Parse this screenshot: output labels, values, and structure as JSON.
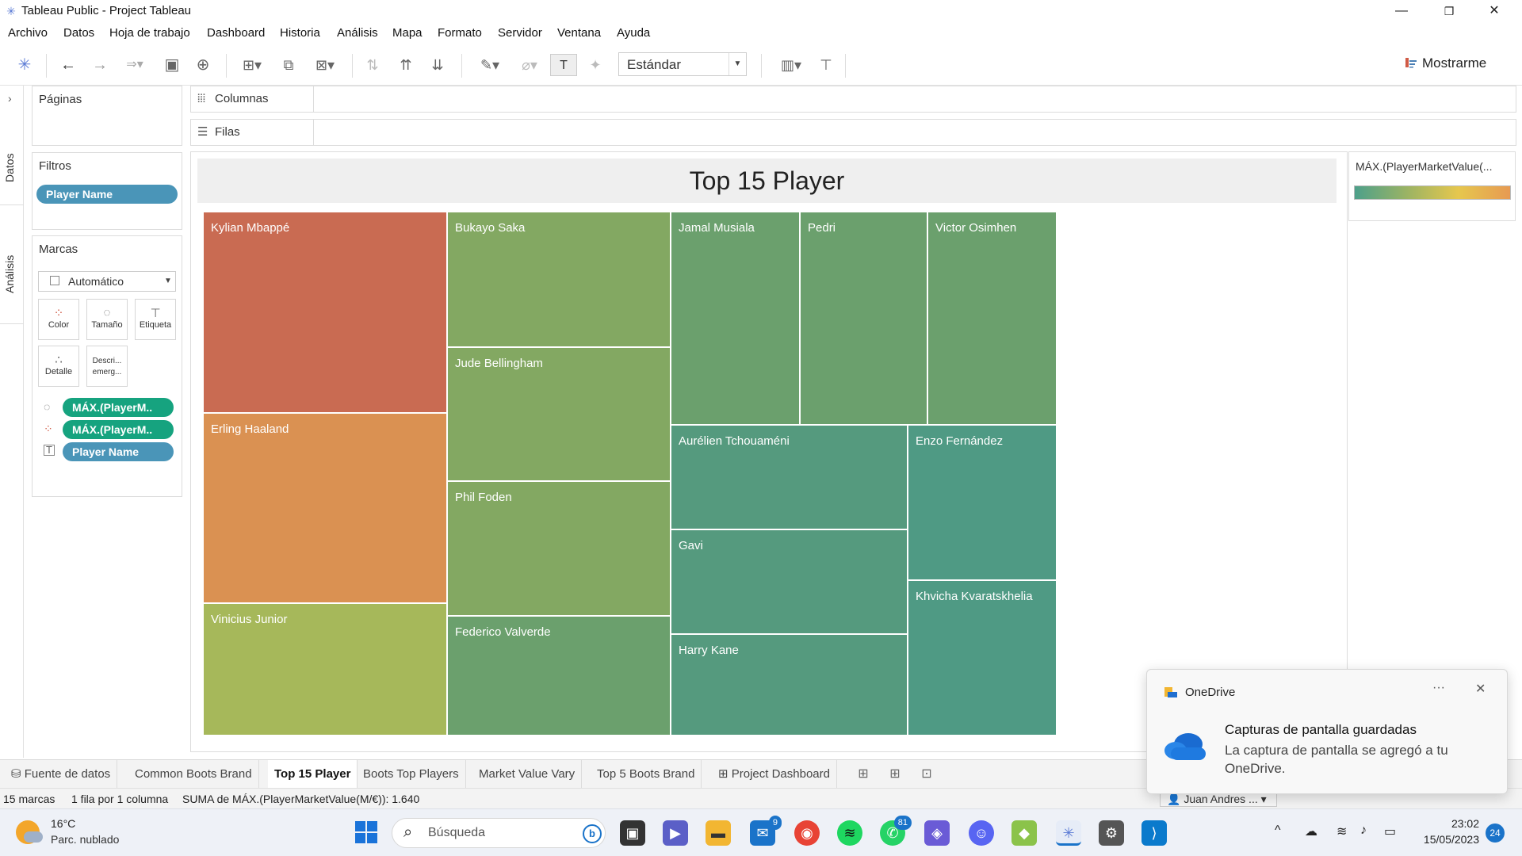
{
  "window": {
    "title": "Tableau Public - Project Tableau",
    "minimize": "—",
    "maximize": "❐",
    "close": "✕"
  },
  "menu": [
    "Archivo",
    "Datos",
    "Hoja de trabajo",
    "Dashboard",
    "Historia",
    "Análisis",
    "Mapa",
    "Formato",
    "Servidor",
    "Ventana",
    "Ayuda"
  ],
  "toolbar": {
    "fit_select": "Estándar",
    "show_me": "Mostrarme"
  },
  "side_tabs": {
    "data": "Datos",
    "analysis": "Análisis"
  },
  "pages": {
    "title": "Páginas"
  },
  "filters": {
    "title": "Filtros",
    "pills": [
      "Player Name"
    ]
  },
  "marks": {
    "title": "Marcas",
    "type": "Automático",
    "buttons": {
      "color": "Color",
      "size": "Tamaño",
      "label": "Etiqueta",
      "detail": "Detalle",
      "tooltip": "Descri... emerg..."
    },
    "pills": [
      "MÁX.(PlayerM..",
      "MÁX.(PlayerM..",
      "Player Name"
    ]
  },
  "shelves": {
    "columns": "Columnas",
    "rows": "Filas"
  },
  "view": {
    "title": "Top 15 Player"
  },
  "treemap": [
    {
      "name": "Kylian Mbappé",
      "color": "#c96b52"
    },
    {
      "name": "Erling Haaland",
      "color": "#da9152"
    },
    {
      "name": "Vinicius Junior",
      "color": "#a6b85a"
    },
    {
      "name": "Bukayo Saka",
      "color": "#83a862"
    },
    {
      "name": "Jude Bellingham",
      "color": "#83a862"
    },
    {
      "name": "Phil Foden",
      "color": "#83a862"
    },
    {
      "name": "Federico Valverde",
      "color": "#6ba06d"
    },
    {
      "name": "Jamal Musiala",
      "color": "#6ba06d"
    },
    {
      "name": "Pedri",
      "color": "#6ba06d"
    },
    {
      "name": "Victor Osimhen",
      "color": "#6ba06d"
    },
    {
      "name": "Aurélien Tchouaméni",
      "color": "#559a7e"
    },
    {
      "name": "Gavi",
      "color": "#559a7e"
    },
    {
      "name": "Harry Kane",
      "color": "#559a7e"
    },
    {
      "name": "Enzo Fernández",
      "color": "#4f9a84"
    },
    {
      "name": "Khvicha Kvaratskhelia",
      "color": "#4f9a84"
    }
  ],
  "legend": {
    "title": "MÁX.(PlayerMarketValue(..."
  },
  "sheet_tabs": [
    "Fuente de datos",
    "Common Boots Brand",
    "Top 15 Player",
    "Boots Top Players",
    "Market Value Vary",
    "Top 5 Boots Brand",
    "Project Dashboard"
  ],
  "active_tab": "Top 15 Player",
  "status": {
    "marks": "15 marcas",
    "rows": "1 fila por 1 columna",
    "sum": "SUMA de MÁX.(PlayerMarketValue(M/€)): 1.640",
    "user": "Juan Andres ..."
  },
  "toast": {
    "app": "OneDrive",
    "title": "Capturas de pantalla guardadas",
    "body": "La captura de pantalla se agregó a tu OneDrive.",
    "more": "···",
    "close": "✕"
  },
  "taskbar": {
    "weather_temp": "16°C",
    "weather_cond": "Parc. nublado",
    "search_placeholder": "Búsqueda",
    "mail_badge": "9",
    "whatsapp_badge": "81",
    "time": "23:02",
    "date": "15/05/2023",
    "notifications": "24"
  }
}
